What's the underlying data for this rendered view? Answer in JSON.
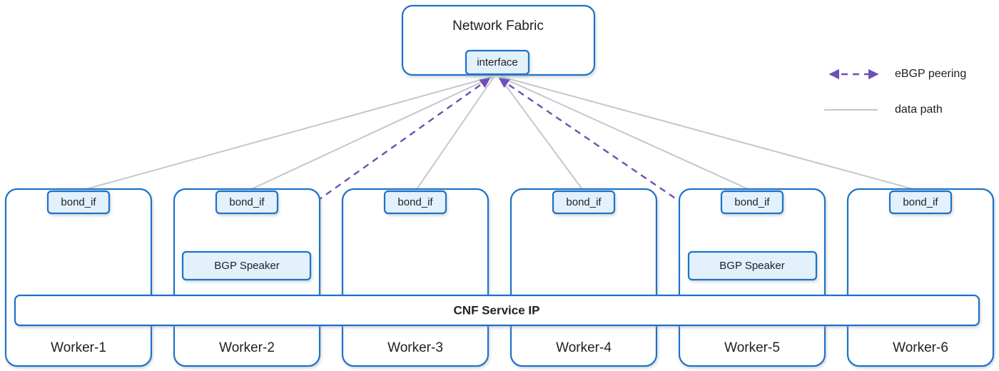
{
  "diagram": {
    "title_node": {
      "label": "Network Fabric",
      "interface_label": "interface"
    },
    "service_bar": {
      "label": "CNF Service IP"
    },
    "workers": [
      {
        "name": "Worker-1",
        "bond_label": "bond_if",
        "has_bgp": false,
        "bgp_label": ""
      },
      {
        "name": "Worker-2",
        "bond_label": "bond_if",
        "has_bgp": true,
        "bgp_label": "BGP Speaker"
      },
      {
        "name": "Worker-3",
        "bond_label": "bond_if",
        "has_bgp": false,
        "bgp_label": ""
      },
      {
        "name": "Worker-4",
        "bond_label": "bond_if",
        "has_bgp": false,
        "bgp_label": ""
      },
      {
        "name": "Worker-5",
        "bond_label": "bond_if",
        "has_bgp": true,
        "bgp_label": "BGP Speaker"
      },
      {
        "name": "Worker-6",
        "bond_label": "bond_if",
        "has_bgp": false,
        "bgp_label": ""
      }
    ],
    "legend": [
      {
        "label": "eBGP peering",
        "style": "dashed-arrow",
        "color": "#6f4fb5"
      },
      {
        "label": "data path",
        "style": "solid-line",
        "color": "#c4c7ce"
      }
    ],
    "colors": {
      "node_border": "#1a73c8",
      "node_fill": "#ffffff",
      "sub_fill": "#e3f1fc",
      "bgp_purple": "#6f4fb5",
      "data_gray": "#c4c7ce",
      "text": "#202124"
    }
  }
}
